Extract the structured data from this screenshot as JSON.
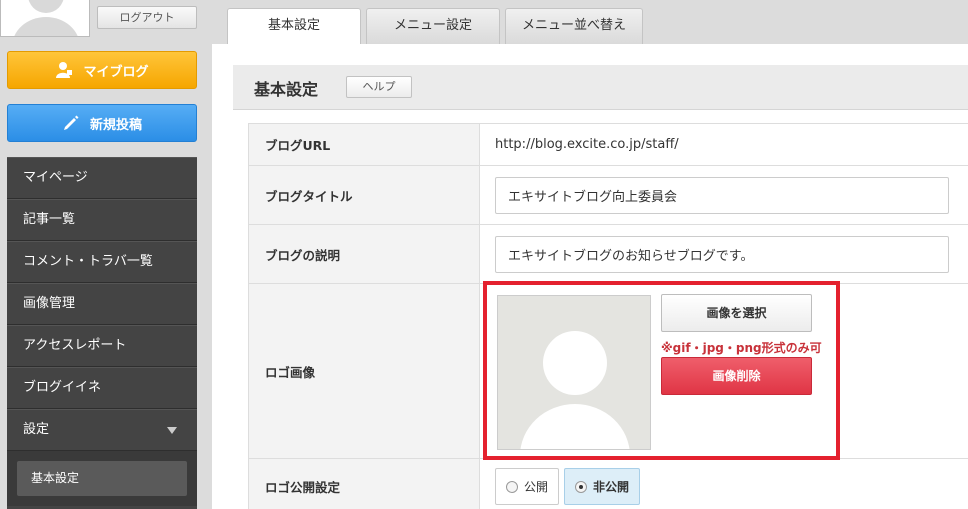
{
  "sidebar": {
    "logout_label": "ログアウト",
    "myblog_label": "マイブログ",
    "newpost_label": "新規投稿",
    "nav": [
      {
        "label": "マイページ"
      },
      {
        "label": "記事一覧"
      },
      {
        "label": "コメント・トラバ一覧"
      },
      {
        "label": "画像管理"
      },
      {
        "label": "アクセスレポート"
      },
      {
        "label": "ブログイイネ"
      },
      {
        "label": "設定"
      }
    ],
    "sub_item": "基本設定"
  },
  "tabs": [
    {
      "label": "基本設定",
      "active": true
    },
    {
      "label": "メニュー設定",
      "active": false
    },
    {
      "label": "メニュー並べ替え",
      "active": false
    }
  ],
  "section": {
    "title": "基本設定",
    "help_label": "ヘルプ"
  },
  "form": {
    "url_label": "ブログURL",
    "url_value": "http://blog.excite.co.jp/staff/",
    "title_label": "ブログタイトル",
    "title_value": "エキサイトブログ向上委員会",
    "desc_label": "ブログの説明",
    "desc_value": "エキサイトブログのお知らせブログです。",
    "logo_label": "ロゴ画像",
    "select_image_label": "画像を選択",
    "format_note": "※gif・jpg・png形式のみ可",
    "delete_image_label": "画像削除",
    "publish_label": "ロゴ公開設定",
    "publish_options": [
      "公開",
      "非公開"
    ],
    "publish_selected": "非公開"
  },
  "colors": {
    "myblog": "#f6a600",
    "newpost": "#2b8ee6",
    "delete": "#e03545",
    "highlight": "#e4212e",
    "nav_bg": "#444444"
  }
}
